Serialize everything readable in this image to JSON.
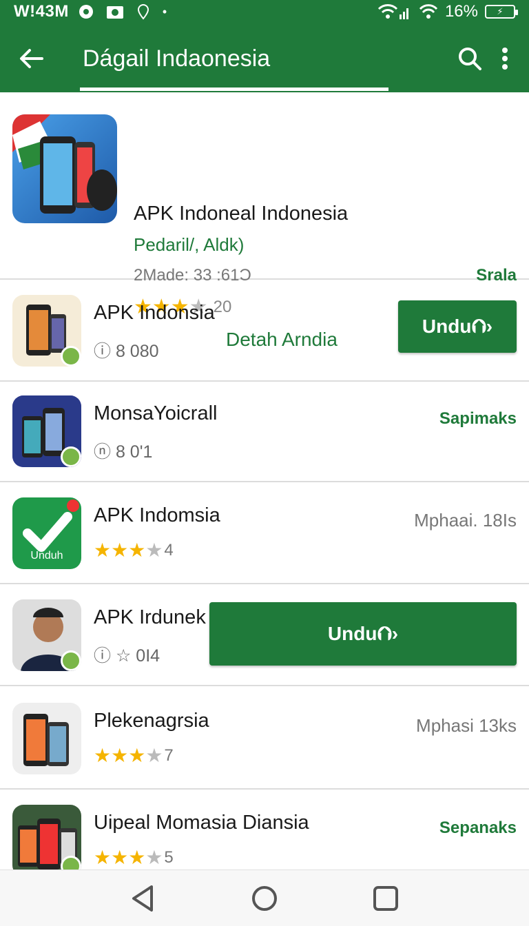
{
  "status": {
    "time": "W!43M",
    "battery": "16%",
    "colors": {
      "bar": "#1f7a3a"
    }
  },
  "toolbar": {
    "title": "Dágail Indaonesia",
    "icons": [
      "back-arrow-icon",
      "search-icon",
      "more-vert-icon"
    ]
  },
  "featured": {
    "title": "APK Indoneal Indonesia",
    "subtitle": "Pedaril/, Aldk)",
    "meta": "2Made: 33 :61Ͻ",
    "right_label": "Srala",
    "rating_count": "20",
    "rating": 3.5,
    "link_label": "Detah Arndia"
  },
  "rows": [
    {
      "name": "APK Indonsia",
      "meta": "ⓘ 8 080",
      "button": "Undu⮉›"
    },
    {
      "name": "MonsaYoicrall",
      "meta": "ⓝ 8 0'1",
      "right_label": "Sapimaks"
    },
    {
      "name": "APK Indomsia",
      "rating_count": "4",
      "rating": 3.5,
      "right_label": "Mphaai. 18Is",
      "icon_label": "Unduh"
    },
    {
      "name": "APK Irdunek",
      "meta": "ⓘ ☆ 0I4",
      "button": "Undu⮉›"
    },
    {
      "name": "Plekenagrsia",
      "rating_count": "7",
      "rating": 3.5,
      "right_label": "Mphasi 13ks"
    },
    {
      "name": "Uipeal Momasia Diansia",
      "rating_count": "5",
      "rating": 3.5,
      "right_label": "Sepanaks"
    }
  ],
  "navbar": {
    "icons": [
      "back-triangle-icon",
      "home-circle-icon",
      "recents-square-icon"
    ]
  }
}
